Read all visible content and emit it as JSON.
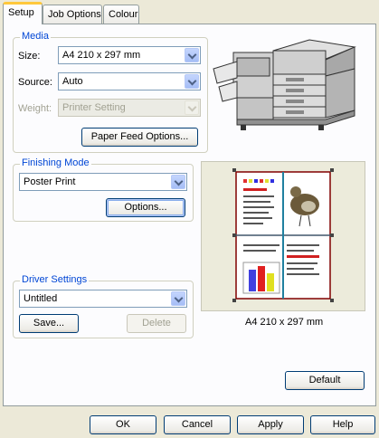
{
  "tabs": [
    {
      "label": "Setup",
      "active": true
    },
    {
      "label": "Job Options",
      "active": false
    },
    {
      "label": "Colour",
      "active": false
    }
  ],
  "media": {
    "title": "Media",
    "size_label": "Size:",
    "size_value": "A4 210 x 297 mm",
    "source_label": "Source:",
    "source_value": "Auto",
    "weight_label": "Weight:",
    "weight_value": "Printer Setting",
    "paper_feed_button": "Paper Feed Options..."
  },
  "finishing": {
    "title": "Finishing Mode",
    "mode_value": "Poster Print",
    "options_button": "Options..."
  },
  "driver": {
    "title": "Driver Settings",
    "value": "Untitled",
    "save_button": "Save...",
    "delete_button": "Delete"
  },
  "preview": {
    "caption": "A4 210 x 297 mm"
  },
  "default_button": "Default",
  "footer": {
    "ok": "OK",
    "cancel": "Cancel",
    "apply": "Apply",
    "help": "Help"
  },
  "colors": {
    "tab_highlight": "#ffc83c",
    "group_title": "#0046d5",
    "preview_bar_1": "#4040e0",
    "preview_bar_2": "#e02020",
    "preview_bar_3": "#e0e020"
  }
}
